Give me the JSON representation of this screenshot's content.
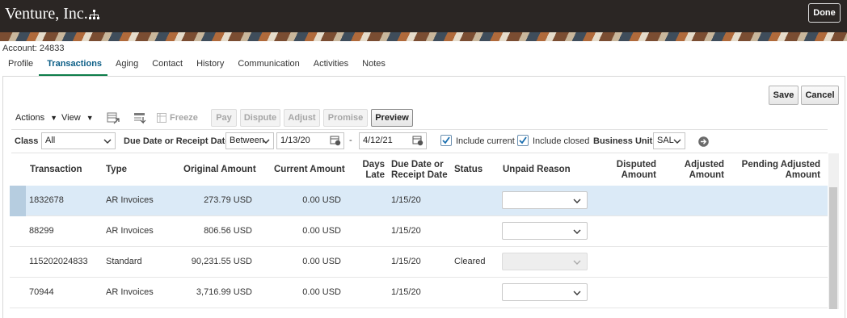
{
  "app": {
    "title": "Venture, Inc.",
    "done_label": "Done"
  },
  "account": {
    "label": "Account: 24833"
  },
  "tabs": [
    {
      "label": "Profile"
    },
    {
      "label": "Transactions"
    },
    {
      "label": "Aging"
    },
    {
      "label": "Contact"
    },
    {
      "label": "History"
    },
    {
      "label": "Communication"
    },
    {
      "label": "Activities"
    },
    {
      "label": "Notes"
    }
  ],
  "active_tab": "Transactions",
  "actions": {
    "save_label": "Save",
    "cancel_label": "Cancel"
  },
  "toolbar": {
    "actions_label": "Actions",
    "view_label": "View",
    "freeze_label": "Freeze",
    "pay_label": "Pay",
    "dispute_label": "Dispute",
    "adjust_label": "Adjust",
    "promise_label": "Promise",
    "preview_label": "Preview"
  },
  "filters": {
    "class_label": "Class",
    "class_value": "All",
    "due_label": "Due Date or Receipt Date",
    "operator_value": "Between",
    "date_from": "1/13/20",
    "date_sep": "-",
    "date_to": "4/12/21",
    "include_current_label": "Include current",
    "include_current_checked": true,
    "include_closed_label": "Include closed",
    "include_closed_checked": true,
    "bu_label": "Business Unit",
    "bu_value": "SAL"
  },
  "table": {
    "headers": {
      "transaction": "Transaction",
      "type": "Type",
      "original_amount": "Original Amount",
      "current_amount": "Current Amount",
      "days_late_1": "Days",
      "days_late_2": "Late",
      "due_date_1": "Due Date or",
      "due_date_2": "Receipt Date",
      "status": "Status",
      "unpaid_reason": "Unpaid Reason",
      "disputed_1": "Disputed",
      "disputed_2": "Amount",
      "adjusted_1": "Adjusted",
      "adjusted_2": "Amount",
      "pending_1": "Pending Adjusted",
      "pending_2": "Amount"
    },
    "rows": [
      {
        "transaction": "1832678",
        "type": "AR Invoices",
        "original": "273.79 USD",
        "current": "0.00 USD",
        "due": "1/15/20",
        "status": ""
      },
      {
        "transaction": "88299",
        "type": "AR Invoices",
        "original": "806.56 USD",
        "current": "0.00 USD",
        "due": "1/15/20",
        "status": ""
      },
      {
        "transaction": "115202024833",
        "type": "Standard",
        "original": "90,231.55 USD",
        "current": "0.00 USD",
        "due": "1/15/20",
        "status": "Cleared"
      },
      {
        "transaction": "70944",
        "type": "AR Invoices",
        "original": "3,716.99 USD",
        "current": "0.00 USD",
        "due": "1/15/20",
        "status": ""
      }
    ]
  }
}
